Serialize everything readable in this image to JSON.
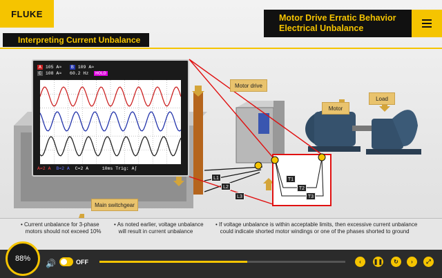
{
  "header": {
    "logo": "FLUKE",
    "title_line1": "Motor Drive Erratic Behavior",
    "title_line2": "Electrical Unbalance",
    "section_title": "Interpreting Current Unbalance"
  },
  "scope": {
    "hdr_a": "A",
    "hdr_a_val": "105  A≈",
    "hdr_b": "B",
    "hdr_b_val": "109  A≈",
    "hdr_c": "C",
    "hdr_c_val": "108  A≈",
    "hdr_freq": "60.2  Hz",
    "hold": "HOLD",
    "footer_a": "A=2 A",
    "footer_b": "B=2 A",
    "footer_c": "C=2 A",
    "footer_trig": "10ms Trig: A∫",
    "trace_colors": {
      "a": "#cc2222",
      "b": "#2233aa",
      "c": "#222222"
    }
  },
  "diagram": {
    "motor_drive": "Motor drive",
    "motor": "Motor",
    "load": "Load",
    "main_switchgear": "Main switchgear",
    "l1": "L1",
    "l2": "L2",
    "l3": "L3",
    "t1": "T1",
    "t2": "T2",
    "t3": "T3"
  },
  "bullets": [
    {
      "text": "• Current unbalance for 3-phase\n   motors should not exceed 10%"
    },
    {
      "text": "• As noted earlier, voltage unbalance\n   will result in current unbalance"
    },
    {
      "text": "• If voltage unbalance is within acceptable limits, then excessive current unbalance\n   could indicate shorted motor windings or one of the phases shorted to ground"
    }
  ],
  "controls": {
    "progress_pct": "88%",
    "audio_label": "OFF",
    "seek_fraction": 0.6,
    "accent": "#f5c400"
  }
}
